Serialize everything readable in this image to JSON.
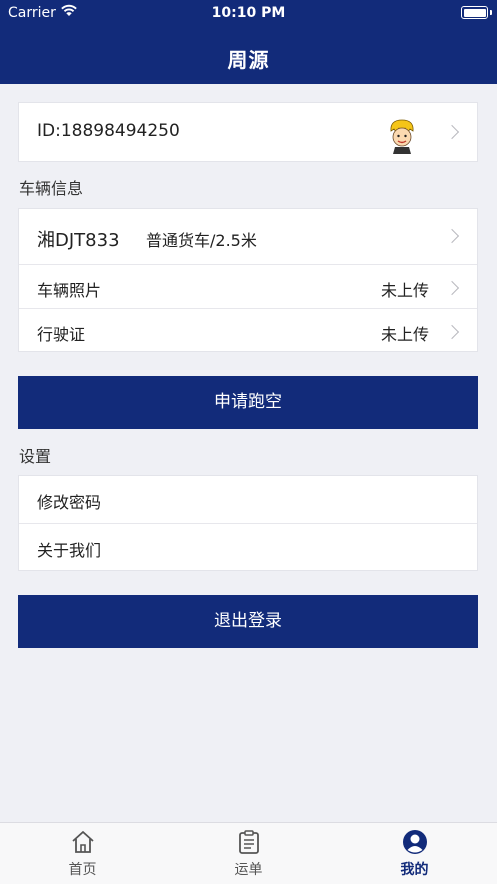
{
  "status_bar": {
    "carrier": "Carrier",
    "time": "10:10 PM"
  },
  "nav": {
    "title": "周源"
  },
  "profile": {
    "id_text": "ID:18898494250"
  },
  "vehicle_section": {
    "heading": "车辆信息",
    "plate": "湘DJT833",
    "type": "普通货车/2.5米",
    "photos_label": "车辆照片",
    "photos_status": "未上传",
    "license_label": "行驶证",
    "license_status": "未上传"
  },
  "apply_button": "申请跑空",
  "settings_section": {
    "heading": "设置",
    "change_password": "修改密码",
    "about_us": "关于我们"
  },
  "logout_button": "退出登录",
  "tabbar": {
    "tabs": [
      {
        "label": "首页",
        "icon": "home-icon",
        "active": false
      },
      {
        "label": "运单",
        "icon": "clipboard-icon",
        "active": false
      },
      {
        "label": "我的",
        "icon": "user-icon",
        "active": true
      }
    ]
  },
  "colors": {
    "primary": "#122b7a",
    "background": "#eff0f5"
  }
}
